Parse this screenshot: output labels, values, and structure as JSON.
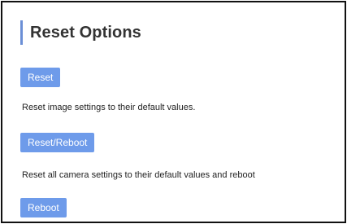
{
  "panel": {
    "title": "Reset Options"
  },
  "actions": [
    {
      "button_label": "Reset",
      "description": "Reset image settings to their default values."
    },
    {
      "button_label": "Reset/Reboot",
      "description": "Reset all camera settings to their default values and reboot"
    },
    {
      "button_label": "Reboot",
      "description": ""
    }
  ],
  "colors": {
    "accent": "#6b8fd6",
    "button_bg": "#6e9bea",
    "button_text": "#ffffff",
    "text": "#222222",
    "title_text": "#333333",
    "border": "#111111"
  }
}
